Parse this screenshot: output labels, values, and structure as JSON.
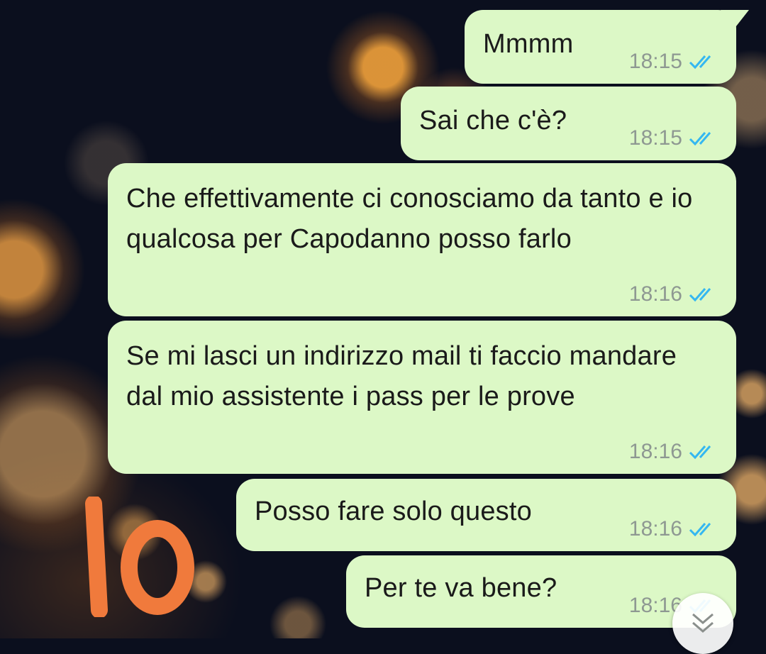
{
  "messages": [
    {
      "text": "Mmmm",
      "time": "18:15"
    },
    {
      "text": "Sai che c'è?",
      "time": "18:15"
    },
    {
      "text": "Che effettivamente ci conosciamo da tanto e io qualcosa per Capodanno posso farlo",
      "time": "18:16"
    },
    {
      "text": "Se mi lasci un indirizzo mail ti faccio mandare dal mio assistente i pass per le prove",
      "time": "18:16"
    },
    {
      "text": "Posso fare solo questo",
      "time": "18:16"
    },
    {
      "text": "Per te va bene?",
      "time": "18:16"
    }
  ],
  "annotation": {
    "text": "IO",
    "color": "#f07a3c"
  },
  "colors": {
    "bubble_outgoing": "#dcf8c6",
    "read_ticks": "#34b7f1",
    "timestamp": "#8e9892"
  },
  "icons": {
    "read_receipt": "double-check-icon",
    "scroll": "chevron-double-down-icon"
  }
}
